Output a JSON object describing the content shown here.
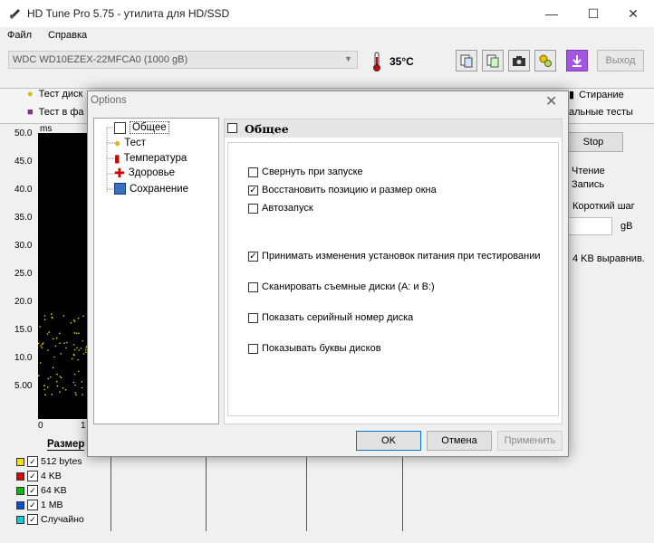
{
  "window": {
    "title": "HD Tune Pro 5.75 - утилита для HD/SSD"
  },
  "menu": {
    "file": "Файл",
    "help": "Справка"
  },
  "toolbar": {
    "drive": "WDC WD10EZEX-22MFCA0 (1000 gB)",
    "temperature": "35°C",
    "exit_label": "Выход"
  },
  "tabs": {
    "row1_left": "Тест диск",
    "row1_right": "Стирание",
    "row2_left": "Тест в фа",
    "row2_right": "альные тесты"
  },
  "right_panel": {
    "stop_label": "Stop",
    "read": "Чтение",
    "write": "Запись",
    "short_step": "Короткий шаг",
    "size_unit": "gB",
    "align": "4 KB выравнив."
  },
  "chart": {
    "unit": "ms",
    "y_ticks": [
      "50.0",
      "45.0",
      "40.0",
      "35.0",
      "30.0",
      "25.0",
      "20.0",
      "15.0",
      "10.0",
      "5.00"
    ],
    "x_ticks": [
      "0",
      "1"
    ],
    "xlabel": "Размер"
  },
  "legend": [
    {
      "label": "512 bytes",
      "color": "#f5e000"
    },
    {
      "label": "4 KB",
      "color": "#e00000"
    },
    {
      "label": "64 KB",
      "color": "#00c000"
    },
    {
      "label": "1 MB",
      "color": "#0050e0"
    },
    {
      "label": "Случайно",
      "color": "#00d0e0"
    }
  ],
  "dialog": {
    "title": "Options",
    "tree": [
      "Общее",
      "Тест",
      "Температура",
      "Здоровье",
      "Сохранение"
    ],
    "panel_title": "Общее",
    "options": [
      {
        "label": "Свернуть при запуске",
        "checked": false
      },
      {
        "label": "Восстановить позицию и размер окна",
        "checked": true
      },
      {
        "label": "Автозапуск",
        "checked": false
      },
      {
        "label": "Принимать изменения установок питания при тестировании",
        "checked": true
      },
      {
        "label": "Сканировать съемные диски (A: и B:)",
        "checked": false
      },
      {
        "label": "Показать серийный номер диска",
        "checked": false
      },
      {
        "label": "Показывать буквы дисков",
        "checked": false
      }
    ],
    "ok": "OK",
    "cancel": "Отмена",
    "apply": "Применить"
  }
}
